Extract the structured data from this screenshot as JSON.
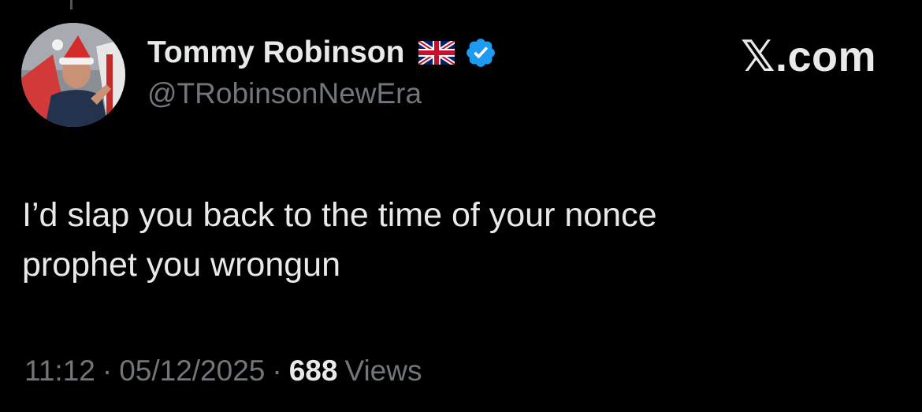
{
  "tweet": {
    "author": {
      "display_name": "Tommy Robinson",
      "flag_icon": "uk-flag-icon",
      "verified_icon": "verified-badge-icon",
      "verified_color": "#1d9bf0",
      "handle": "@TRobinsonNewEra",
      "avatar_icon": "profile-avatar"
    },
    "brand": "𝕏.com",
    "text": "I’d slap you back to the time of your nonce\nprophet you wrongun",
    "meta": {
      "time": "11:12",
      "separator": "·",
      "date": "05/12/2025",
      "views_count": "688",
      "views_label": "Views"
    }
  },
  "colors": {
    "background": "#000000",
    "primary_text": "#e7e9ea",
    "secondary_text": "#71767b"
  }
}
